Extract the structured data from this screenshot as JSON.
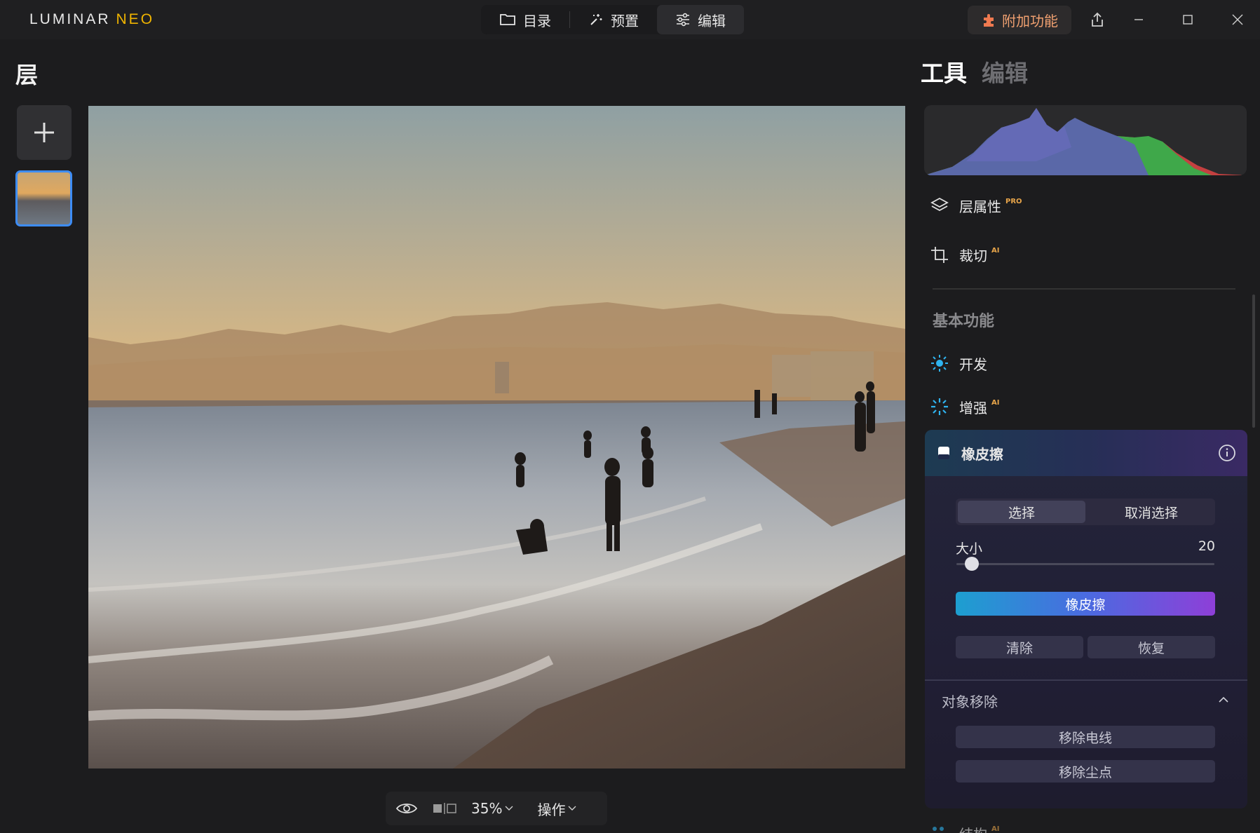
{
  "app": {
    "logo_main": "LUMINAR",
    "logo_accent": "NEO",
    "accent_color": "#f0b400"
  },
  "topnav": {
    "tabs": [
      {
        "label": "目录",
        "icon": "folder-icon"
      },
      {
        "label": "预置",
        "icon": "sparkle-icon"
      },
      {
        "label": "编辑",
        "icon": "sliders-icon",
        "active": true
      }
    ]
  },
  "header_right": {
    "addons_label": "附加功能"
  },
  "layers": {
    "title": "层"
  },
  "bottombar": {
    "zoom": "35%",
    "actions_label": "操作"
  },
  "right_panel": {
    "tab_tools": "工具",
    "tab_edits": "编辑",
    "tools": [
      {
        "label": "层属性",
        "badge": "PRO",
        "icon": "layers-icon"
      },
      {
        "label": "裁切",
        "badge": "AI",
        "icon": "crop-icon"
      }
    ],
    "section_basic": "基本功能",
    "basic": [
      {
        "label": "开发",
        "badge": "",
        "icon": "sun-icon"
      },
      {
        "label": "增强",
        "badge": "AI",
        "icon": "burst-icon"
      }
    ],
    "eraser": {
      "title": "橡皮擦",
      "select_label": "选择",
      "deselect_label": "取消选择",
      "size_label": "大小",
      "size_value": "20",
      "size_fraction": 0.06,
      "erase_label": "橡皮擦",
      "clear_label": "清除",
      "restore_label": "恢复",
      "object_removal_label": "对象移除",
      "remove_lines_label": "移除电线",
      "remove_dust_label": "移除尘点"
    },
    "next_tool": {
      "label": "结构",
      "badge": "AI"
    }
  }
}
